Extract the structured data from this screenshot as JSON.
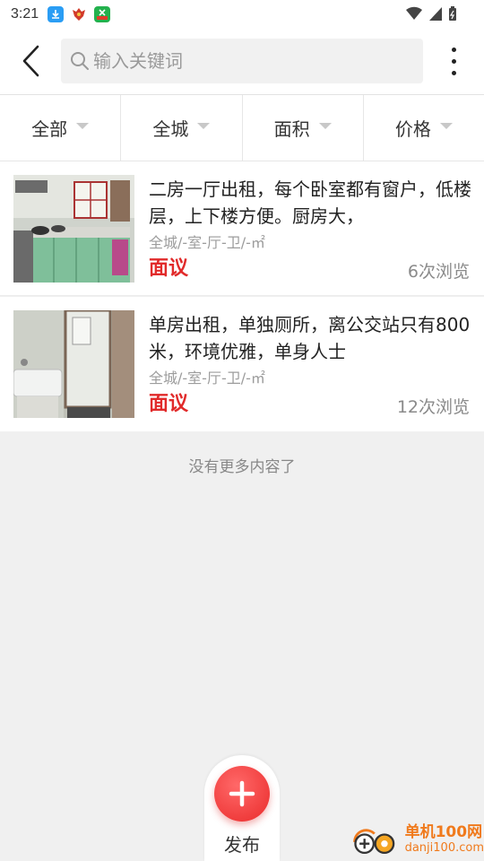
{
  "status_bar": {
    "time": "3:21"
  },
  "header": {
    "search_placeholder": "输入关键词"
  },
  "filters": [
    {
      "label": "全部"
    },
    {
      "label": "全城"
    },
    {
      "label": "面积"
    },
    {
      "label": "价格"
    }
  ],
  "listings": [
    {
      "title": "二房一厅出租，每个卧室都有窗户，低楼层，上下楼方便。厨房大，",
      "meta": "全城/-室-厅-卫/-㎡",
      "price": "面议",
      "views": "6次浏览"
    },
    {
      "title": "单房出租，单独厕所，离公交站只有800米，环境优雅，单身人士",
      "meta": "全城/-室-厅-卫/-㎡",
      "price": "面议",
      "views": "12次浏览"
    }
  ],
  "footer_note": "没有更多内容了",
  "publish": {
    "label": "发布"
  },
  "watermark": {
    "title": "单机100网",
    "url": "danji100.com"
  },
  "colors": {
    "accent_red": "#e12a2a",
    "watermark_orange": "#f07a1c"
  }
}
